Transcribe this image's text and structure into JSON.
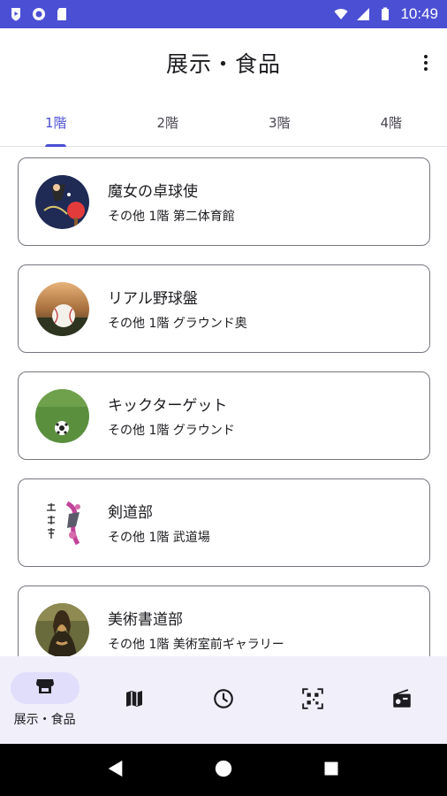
{
  "status_bar": {
    "time": "10:49"
  },
  "app_bar": {
    "title": "展示・食品"
  },
  "tabs": [
    {
      "label": "1階",
      "active": true
    },
    {
      "label": "2階",
      "active": false
    },
    {
      "label": "3階",
      "active": false
    },
    {
      "label": "4階",
      "active": false
    }
  ],
  "items": [
    {
      "title": "魔女の卓球使",
      "subtitle": "その他 1階 第二体育館",
      "icon": "table-tennis-thumbnail"
    },
    {
      "title": "リアル野球盤",
      "subtitle": "その他 1階 グラウンド奥",
      "icon": "baseball-thumbnail"
    },
    {
      "title": "キックターゲット",
      "subtitle": "その他 1階 グラウンド",
      "icon": "soccer-ball-thumbnail"
    },
    {
      "title": "剣道部",
      "subtitle": "その他 1階 武道場",
      "icon": "kendo-thumbnail"
    },
    {
      "title": "美術書道部",
      "subtitle": "その他 1階 美術室前ギャラリー",
      "icon": "mona-lisa-thumbnail"
    }
  ],
  "bottom_nav": [
    {
      "label": "展示・食品",
      "icon": "storefront-icon",
      "active": true
    },
    {
      "label": "",
      "icon": "map-icon",
      "active": false
    },
    {
      "label": "",
      "icon": "clock-icon",
      "active": false
    },
    {
      "label": "",
      "icon": "qr-scanner-icon",
      "active": false
    },
    {
      "label": "",
      "icon": "radio-icon",
      "active": false
    }
  ],
  "colors": {
    "primary": "#4b4fd4",
    "nav_background": "#f1effa",
    "active_pill": "#e1defc",
    "card_border": "#79747e"
  }
}
